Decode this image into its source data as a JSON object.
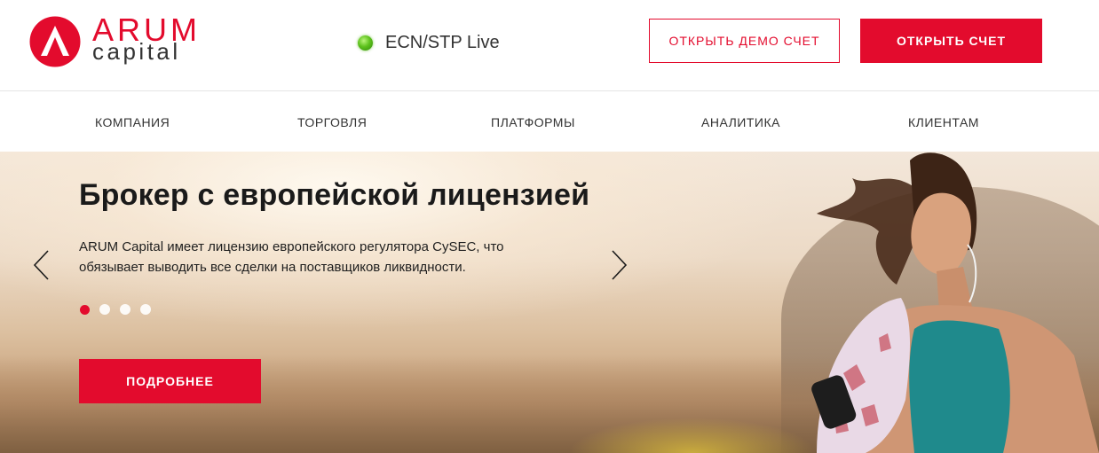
{
  "logo": {
    "name": "ARUM",
    "sub": "capital",
    "icon": "arum-logo-icon"
  },
  "status": {
    "label": "ECN/STP Live",
    "color": "#5ec21d"
  },
  "buttons": {
    "demo": "ОТКРЫТЬ ДЕМО СЧЕТ",
    "open": "ОТКРЫТЬ СЧЕТ",
    "more": "ПОДРОБНЕЕ"
  },
  "nav": {
    "items": [
      {
        "label": "КОМПАНИЯ"
      },
      {
        "label": "ТОРГОВЛЯ"
      },
      {
        "label": "ПЛАТФОРМЫ"
      },
      {
        "label": "АНАЛИТИКА"
      },
      {
        "label": "КЛИЕНТАМ"
      }
    ]
  },
  "hero": {
    "title": "Брокер с европейской лицензией",
    "text": "ARUM Capital имеет лицензию европейского регулятора CySEC, что обязывает выводить все сделки на поставщиков ликвидности.",
    "slides_total": 4,
    "active_slide": 1
  },
  "colors": {
    "brand": "#e30b2d",
    "text": "#333333"
  }
}
